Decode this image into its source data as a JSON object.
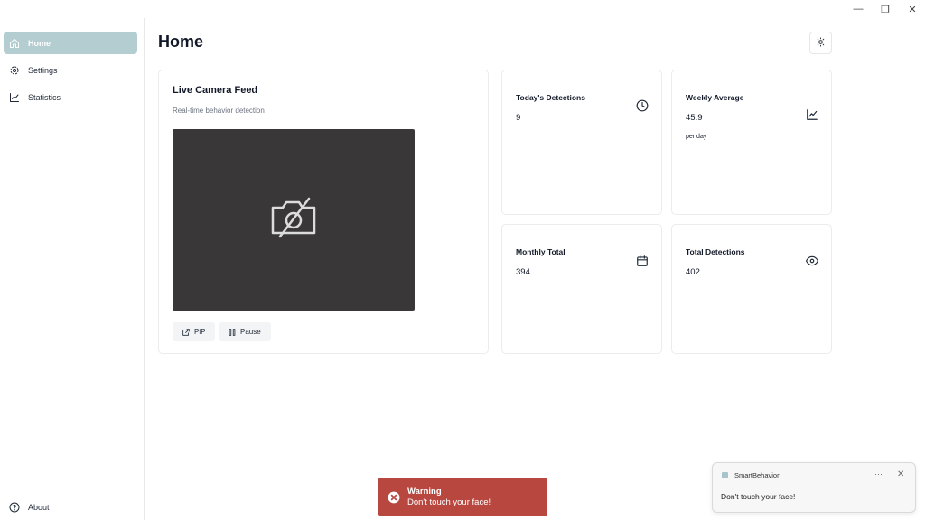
{
  "window": {
    "controls": {
      "minimize": "—",
      "restore": "❐",
      "close": "✕"
    }
  },
  "sidebar": {
    "items": [
      {
        "label": "Home",
        "icon": "home-icon",
        "active": true
      },
      {
        "label": "Settings",
        "icon": "gear-icon",
        "active": false
      },
      {
        "label": "Statistics",
        "icon": "chart-line-icon",
        "active": false
      }
    ],
    "about": {
      "label": "About",
      "icon": "help-circle-icon"
    }
  },
  "header": {
    "title": "Home",
    "theme_toggle_icon": "sun-icon"
  },
  "camera": {
    "title": "Live Camera Feed",
    "subtitle": "Real-time behavior detection",
    "feed_icon": "camera-off-icon",
    "pip_label": "PiP",
    "pause_label": "Pause"
  },
  "stats": {
    "today": {
      "label": "Today's Detections",
      "value": "9",
      "icon": "clock-icon"
    },
    "weekly": {
      "label": "Weekly Average",
      "value": "45.9",
      "sub": "per day",
      "icon": "trend-chart-icon"
    },
    "monthly": {
      "label": "Monthly Total",
      "value": "394",
      "icon": "calendar-icon"
    },
    "total": {
      "label": "Total Detections",
      "value": "402",
      "icon": "eye-icon"
    }
  },
  "toast": {
    "title": "Warning",
    "message": "Don't touch your face!",
    "color": "#b8483f"
  },
  "notification": {
    "app": "SmartBehavior",
    "more": "···",
    "close": "✕",
    "message": "Don't touch your face!"
  },
  "colors": {
    "accent": "#b3cdd1",
    "camera_bg": "#3a3739"
  }
}
